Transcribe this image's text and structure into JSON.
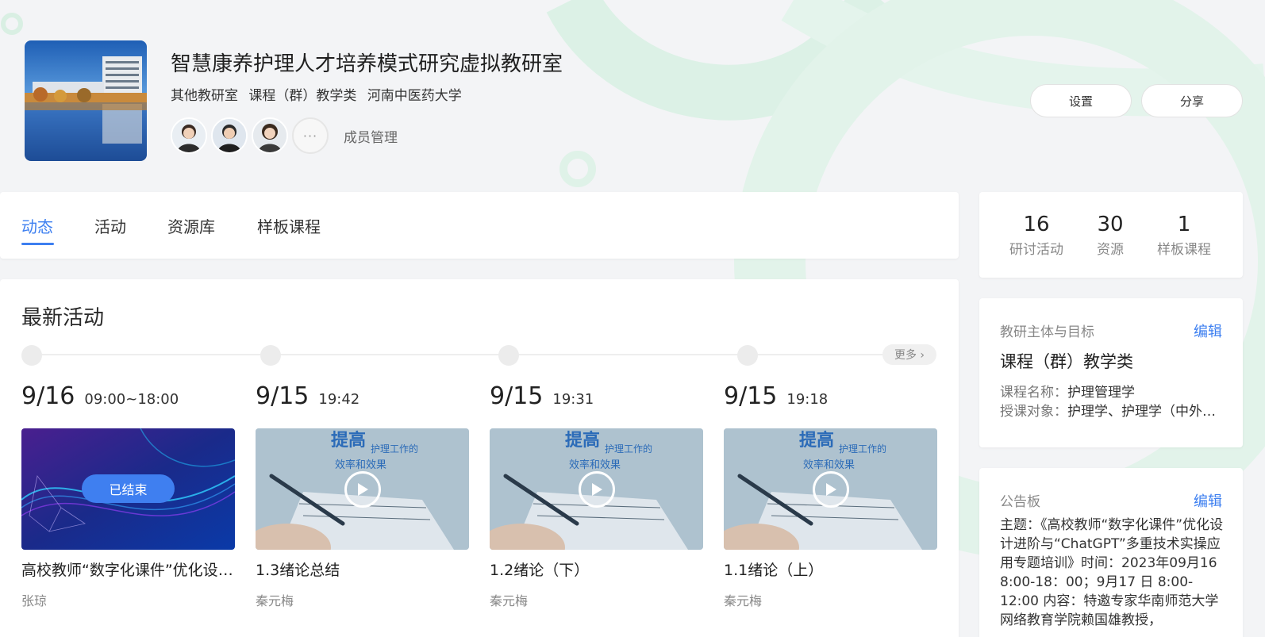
{
  "header": {
    "title": "智慧康养护理人才培养模式研究虚拟教研室",
    "tags": [
      "其他教研室",
      "课程（群）教学类",
      "河南中医药大学"
    ],
    "member_more": "···",
    "member_manage": "成员管理",
    "settings_label": "设置",
    "share_label": "分享"
  },
  "tabs": [
    "动态",
    "活动",
    "资源库",
    "样板课程"
  ],
  "activity": {
    "section_title": "最新活动",
    "more_label": "更多 ›",
    "items": [
      {
        "date": "9/16",
        "time": "09:00~18:00",
        "name": "高校教师“数字化课件”优化设计进阶与“ChatGPT”多重技术实操应用专题培训",
        "author": "张琼",
        "status": "已结束"
      },
      {
        "date": "9/15",
        "time": "19:42",
        "name": "1.3绪论总结",
        "author": "秦元梅"
      },
      {
        "date": "9/15",
        "time": "19:31",
        "name": "1.2绪论（下）",
        "author": "秦元梅"
      },
      {
        "date": "9/15",
        "time": "19:18",
        "name": "1.1绪论（上）",
        "author": "秦元梅"
      }
    ],
    "thumb_text_line1": "提高",
    "thumb_text_line2": "护理工作的",
    "thumb_text_line3": "效率和效果"
  },
  "stats": [
    {
      "value": "16",
      "label": "研讨活动"
    },
    {
      "value": "30",
      "label": "资源"
    },
    {
      "value": "1",
      "label": "样板课程"
    }
  ],
  "goal": {
    "heading": "教研主体与目标",
    "edit_label": "编辑",
    "type": "课程（群）教学类",
    "course_label": "课程名称：",
    "course_value": "护理管理学",
    "target_label": "授课对象：",
    "target_value": "护理学、护理学（中外合作办学）"
  },
  "notice": {
    "heading": "公告板",
    "edit_label": "编辑",
    "body": "主题：《高校教师“数字化课件”优化设计进阶与“ChatGPT”多重技术实操应用专题培训》时间：2023年09月16 8:00-18：00；9月17 日 8:00-12:00 内容：特邀专家华南师范大学网络教育学院赖国雄教授，"
  },
  "colors": {
    "accent": "#3d7ff0",
    "deco": "#d8f0e4"
  }
}
